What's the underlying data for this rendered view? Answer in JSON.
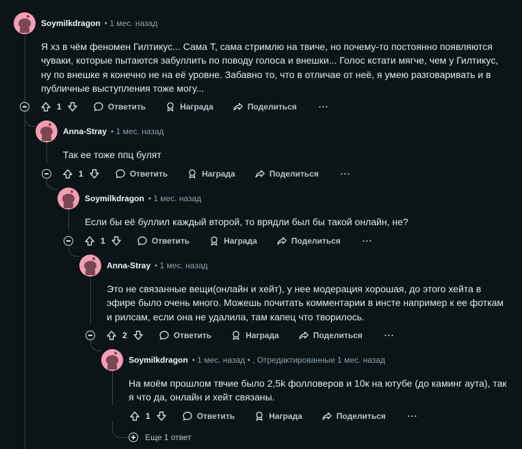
{
  "comments": [
    {
      "author": "Soymilkdragon",
      "meta": "• 1 мес. назад",
      "text": "Я хз в чём феномен Гилтикус... Сама Т, сама стримлю на твиче, но почему-то постоянно появляются\nчуваки, которые пытаются забуллить по поводу голоса и внешки... Голос кстати мягче, чем у Гилтикус,\nну по внешке я конечно не на её уровне. Забавно то, что в отличае от неё, я умею разговаривать и в\nпубличные выступления тоже могу...",
      "votes": "1"
    },
    {
      "author": "Anna-Stray",
      "meta": "• 1 мес. назад",
      "text": "Так ее тоже ппц булят",
      "votes": "1"
    },
    {
      "author": "Soymilkdragon",
      "meta": "• 1 мес. назад",
      "text": "Если бы её буллил каждый второй, то врядли был бы такой онлайн, не?",
      "votes": "1"
    },
    {
      "author": "Anna-Stray",
      "meta": "• 1 мес. назад",
      "text": "Это не связанные вещи(онлайн и хейт), у нее модерация хорошая, до этого хейта в\nэфире было очень много. Можешь почитать комментарии в инсте например к ее фоткам\nи рилсам, если она не удалила, там капец что творилось.",
      "votes": "2"
    },
    {
      "author": "Soymilkdragon",
      "meta": "• 1 мес. назад • , Отредактированные 1 мес. назад",
      "text": "На моём прошлом твчие было 2,5k фолловеров и 10к на ютубе (до каминг аута), так\nя что да, онлайн и хейт связаны.",
      "votes": "1"
    }
  ],
  "labels": {
    "reply": "Ответить",
    "award": "Награда",
    "share": "Поделиться",
    "more": "···",
    "more_replies": "Еще 1 ответ"
  },
  "colors": {
    "background": "#0b1416",
    "avatar": "#f49eb1",
    "thread_line": "#3a4448",
    "meta_text": "#8ba2ad"
  }
}
